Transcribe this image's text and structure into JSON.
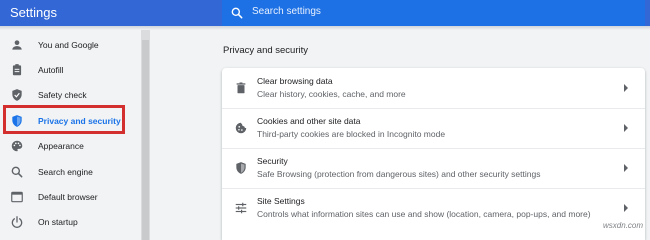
{
  "header": {
    "title": "Settings",
    "search": {
      "placeholder": "Search settings",
      "icon": "search-icon"
    }
  },
  "sidebar": {
    "items": [
      {
        "label": "You and Google",
        "icon": "person-icon",
        "active": false
      },
      {
        "label": "Autofill",
        "icon": "clipboard-icon",
        "active": false
      },
      {
        "label": "Safety check",
        "icon": "shield-check-icon",
        "active": false
      },
      {
        "label": "Privacy and security",
        "icon": "shield-icon",
        "active": true
      },
      {
        "label": "Appearance",
        "icon": "palette-icon",
        "active": false
      },
      {
        "label": "Search engine",
        "icon": "search-icon",
        "active": false
      },
      {
        "label": "Default browser",
        "icon": "browser-icon",
        "active": false
      },
      {
        "label": "On startup",
        "icon": "power-icon",
        "active": false
      }
    ]
  },
  "main": {
    "section_title": "Privacy and security",
    "rows": [
      {
        "title": "Clear browsing data",
        "description": "Clear history, cookies, cache, and more",
        "icon": "trash-icon"
      },
      {
        "title": "Cookies and other site data",
        "description": "Third-party cookies are blocked in Incognito mode",
        "icon": "cookie-icon"
      },
      {
        "title": "Security",
        "description": "Safe Browsing (protection from dangerous sites) and other security settings",
        "icon": "shield-icon"
      },
      {
        "title": "Site Settings",
        "description": "Controls what information sites can use and show (location, camera, pop-ups, and more)",
        "icon": "tune-icon"
      }
    ]
  },
  "watermark": "wsxdn.com",
  "colors": {
    "header": "#3367d6",
    "accent": "#1a73e8",
    "highlight_border": "#d32f2f",
    "background": "#f1f3f4"
  }
}
